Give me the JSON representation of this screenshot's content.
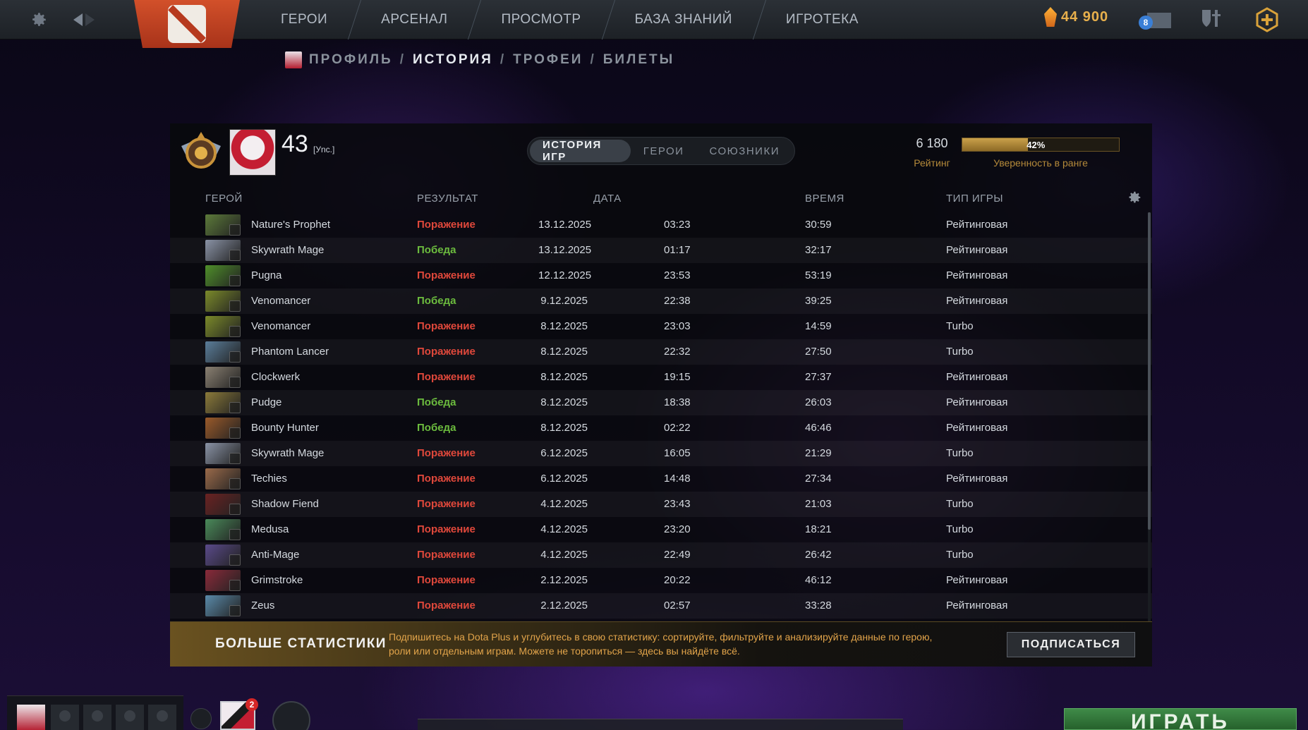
{
  "topbar": {
    "menu": [
      "ГЕРОИ",
      "АРСЕНАЛ",
      "ПРОСМОТР",
      "БАЗА ЗНАНИЙ",
      "ИГРОТЕКА"
    ],
    "shards": "44 900",
    "mail_badge": "8"
  },
  "breadcrumb": {
    "items": [
      "ПРОФИЛЬ",
      "ИСТОРИЯ",
      "ТРОФЕИ",
      "БИЛЕТЫ"
    ],
    "separator": "/",
    "active": "ИСТОРИЯ"
  },
  "profile": {
    "level": "43",
    "tag": "[Уnс.]"
  },
  "tabs": [
    "ИСТОРИЯ ИГР",
    "ГЕРОИ",
    "СОЮЗНИКИ"
  ],
  "rating": {
    "value": "6 180",
    "label": "Рейтинг",
    "confidence_pct": 42,
    "confidence_text": "42%",
    "confidence_label": "Уверенность в ранге"
  },
  "table": {
    "headers": {
      "hero": "ГЕРОЙ",
      "result": "РЕЗУЛЬТАТ",
      "date": "ДАТА",
      "duration": "ВРЕМЯ",
      "mode": "ТИП ИГРЫ"
    },
    "rows": [
      {
        "hero": "Nature's Prophet",
        "result": "Поражение",
        "win": false,
        "date": "13.12.2025",
        "time": "03:23",
        "duration": "30:59",
        "mode": "Рейтинговая",
        "color": "#5c7a3a"
      },
      {
        "hero": "Skywrath Mage",
        "result": "Победа",
        "win": true,
        "date": "13.12.2025",
        "time": "01:17",
        "duration": "32:17",
        "mode": "Рейтинговая",
        "color": "#8a93a6"
      },
      {
        "hero": "Pugna",
        "result": "Поражение",
        "win": false,
        "date": "12.12.2025",
        "time": "23:53",
        "duration": "53:19",
        "mode": "Рейтинговая",
        "color": "#4f8f2a"
      },
      {
        "hero": "Venomancer",
        "result": "Победа",
        "win": true,
        "date": "9.12.2025",
        "time": "22:38",
        "duration": "39:25",
        "mode": "Рейтинговая",
        "color": "#7b8a2a"
      },
      {
        "hero": "Venomancer",
        "result": "Поражение",
        "win": false,
        "date": "8.12.2025",
        "time": "23:03",
        "duration": "14:59",
        "mode": "Turbo",
        "color": "#7b8a2a"
      },
      {
        "hero": "Phantom Lancer",
        "result": "Поражение",
        "win": false,
        "date": "8.12.2025",
        "time": "22:32",
        "duration": "27:50",
        "mode": "Turbo",
        "color": "#5a7d9a"
      },
      {
        "hero": "Clockwerk",
        "result": "Поражение",
        "win": false,
        "date": "8.12.2025",
        "time": "19:15",
        "duration": "27:37",
        "mode": "Рейтинговая",
        "color": "#8a8072"
      },
      {
        "hero": "Pudge",
        "result": "Победа",
        "win": true,
        "date": "8.12.2025",
        "time": "18:38",
        "duration": "26:03",
        "mode": "Рейтинговая",
        "color": "#8b7a3a"
      },
      {
        "hero": "Bounty Hunter",
        "result": "Победа",
        "win": true,
        "date": "8.12.2025",
        "time": "02:22",
        "duration": "46:46",
        "mode": "Рейтинговая",
        "color": "#9a5a2a"
      },
      {
        "hero": "Skywrath Mage",
        "result": "Поражение",
        "win": false,
        "date": "6.12.2025",
        "time": "16:05",
        "duration": "21:29",
        "mode": "Turbo",
        "color": "#8a93a6"
      },
      {
        "hero": "Techies",
        "result": "Поражение",
        "win": false,
        "date": "6.12.2025",
        "time": "14:48",
        "duration": "27:34",
        "mode": "Рейтинговая",
        "color": "#9a6a4a"
      },
      {
        "hero": "Shadow Fiend",
        "result": "Поражение",
        "win": false,
        "date": "4.12.2025",
        "time": "23:43",
        "duration": "21:03",
        "mode": "Turbo",
        "color": "#6a2222"
      },
      {
        "hero": "Medusa",
        "result": "Поражение",
        "win": false,
        "date": "4.12.2025",
        "time": "23:20",
        "duration": "18:21",
        "mode": "Turbo",
        "color": "#4a8a5a"
      },
      {
        "hero": "Anti-Mage",
        "result": "Поражение",
        "win": false,
        "date": "4.12.2025",
        "time": "22:49",
        "duration": "26:42",
        "mode": "Turbo",
        "color": "#5a4a8a"
      },
      {
        "hero": "Grimstroke",
        "result": "Поражение",
        "win": false,
        "date": "2.12.2025",
        "time": "20:22",
        "duration": "46:12",
        "mode": "Рейтинговая",
        "color": "#8a2a3a"
      },
      {
        "hero": "Zeus",
        "result": "Поражение",
        "win": false,
        "date": "2.12.2025",
        "time": "02:57",
        "duration": "33:28",
        "mode": "Рейтинговая",
        "color": "#5a8aaa"
      }
    ]
  },
  "plus_banner": {
    "title": "БОЛЬШЕ СТАТИСТИКИ",
    "text": "Подпишитесь на Dota Plus и углубитесь в свою статистику: сортируйте, фильтруйте и анализируйте данные по герою, роли или отдельным играм. Можете не торопиться — здесь вы найдёте всё.",
    "button": "ПОДПИСАТЬСЯ"
  },
  "bottom": {
    "friend_badge": "2",
    "play_label": "ИГРАТЬ"
  },
  "colors": {
    "loss": "#e0483b",
    "win": "#6cbc3e",
    "gold": "#e8b04c",
    "play": "#3f8b48"
  }
}
